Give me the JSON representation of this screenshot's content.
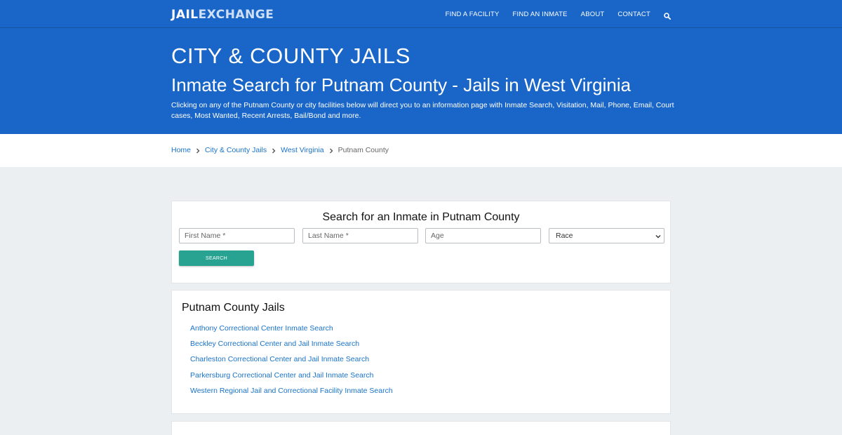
{
  "header": {
    "logo_part1": "JAIL",
    "logo_part2": "EXCHANGE",
    "nav": [
      "FIND A FACILITY",
      "FIND AN INMATE",
      "ABOUT",
      "CONTACT"
    ],
    "search_icon": "search-icon"
  },
  "hero": {
    "title": "CITY & COUNTY JAILS",
    "subtitle": "Inmate Search for Putnam County - Jails in West Virginia",
    "description": "Clicking on any of the Putnam County or city facilities below will direct you to an information page with Inmate Search, Visitation, Mail, Phone, Email, Court cases, Most Wanted, Recent Arrests, Bail/Bond and more."
  },
  "breadcrumb": {
    "items": [
      "Home",
      "City & County Jails",
      "West Virginia"
    ],
    "current": "Putnam County"
  },
  "search": {
    "title": "Search for an Inmate in Putnam County",
    "first_name_placeholder": "First Name *",
    "last_name_placeholder": "Last Name *",
    "age_placeholder": "Age",
    "race_selected": "Race",
    "button_label": "SEARCH"
  },
  "jails": {
    "title": "Putnam County Jails",
    "links": [
      "Anthony Correctional Center Inmate Search",
      "Beckley Correctional Center and Jail Inmate Search",
      "Charleston Correctional Center and Jail Inmate Search",
      "Parkersburg Correctional Center and Jail Inmate Search",
      "Western Regional Jail and Correctional Facility Inmate Search"
    ]
  },
  "colors": {
    "brand_blue": "#1a66c8",
    "link_blue": "#1a73c8",
    "button_teal": "#28a392"
  }
}
